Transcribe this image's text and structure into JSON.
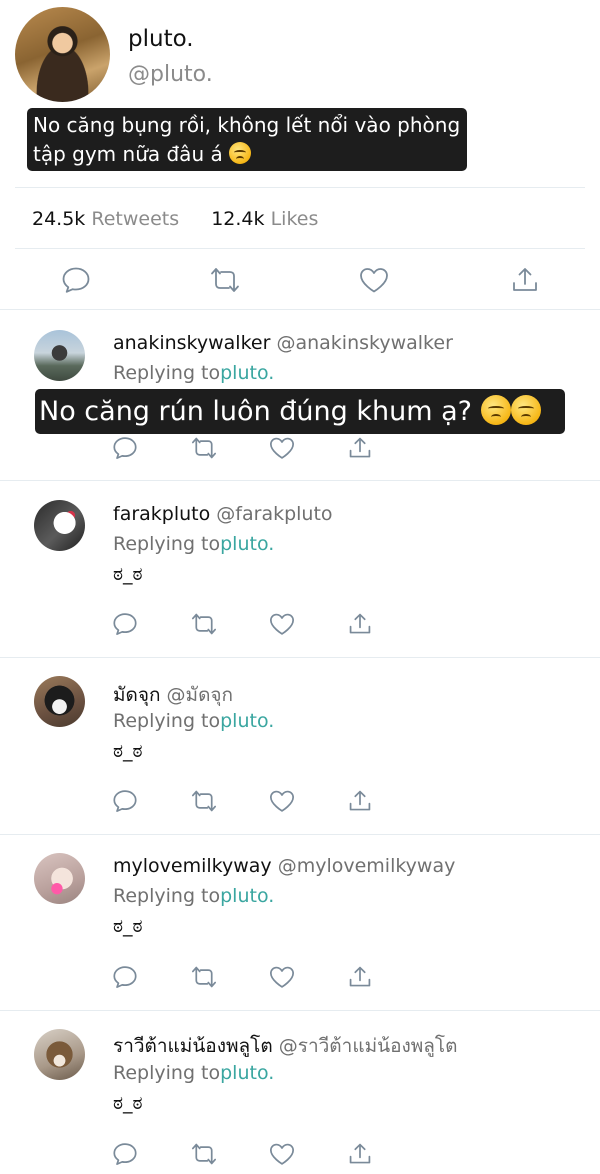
{
  "main_tweet": {
    "name": "pluto.",
    "handle": "@pluto.",
    "caption_line1": "No căng bụng rồi, không lết nổi vào phòng",
    "caption_line2": "tập gym nữa đâu á",
    "caption_emoji": "face-with-steam-icon",
    "retweets_count": "24.5k",
    "retweets_label": "Retweets",
    "likes_count": "12.4k",
    "likes_label": "Likes"
  },
  "replies": [
    {
      "name": "anakinskywalker",
      "handle": "@anakinskywalker",
      "replying_label": "Replying to",
      "replying_mention": "pluto.",
      "text": "",
      "caption": "No căng rún luôn đúng khum ạ?"
    },
    {
      "name": "farakpluto",
      "handle": "@farakpluto",
      "replying_label": "Replying to",
      "replying_mention": "pluto.",
      "text": "ಠ_ಠ"
    },
    {
      "name": "มัดจุก",
      "handle": "@มัดจุก",
      "replying_label": "Replying to",
      "replying_mention": "pluto.",
      "text": "ಠ_ಠ"
    },
    {
      "name": "mylovemilkyway",
      "handle": "@mylovemilkyway",
      "replying_label": "Replying to",
      "replying_mention": "pluto.",
      "text": "ಠ_ಠ"
    },
    {
      "name": "ราวีต้าแม่น้องพลูโต",
      "handle": "@ราวีต้าแม่น้องพลูโต",
      "replying_label": "Replying to",
      "replying_mention": "pluto.",
      "text": "ಠ_ಠ"
    }
  ],
  "icons": {
    "reply": "reply-icon",
    "retweet": "retweet-icon",
    "like": "heart-icon",
    "share": "share-icon"
  },
  "colors": {
    "mention": "#3aa6a0",
    "muted": "#8b8b8b",
    "caption_bg": "#1d1d1d",
    "divider": "#e6ecf0"
  }
}
